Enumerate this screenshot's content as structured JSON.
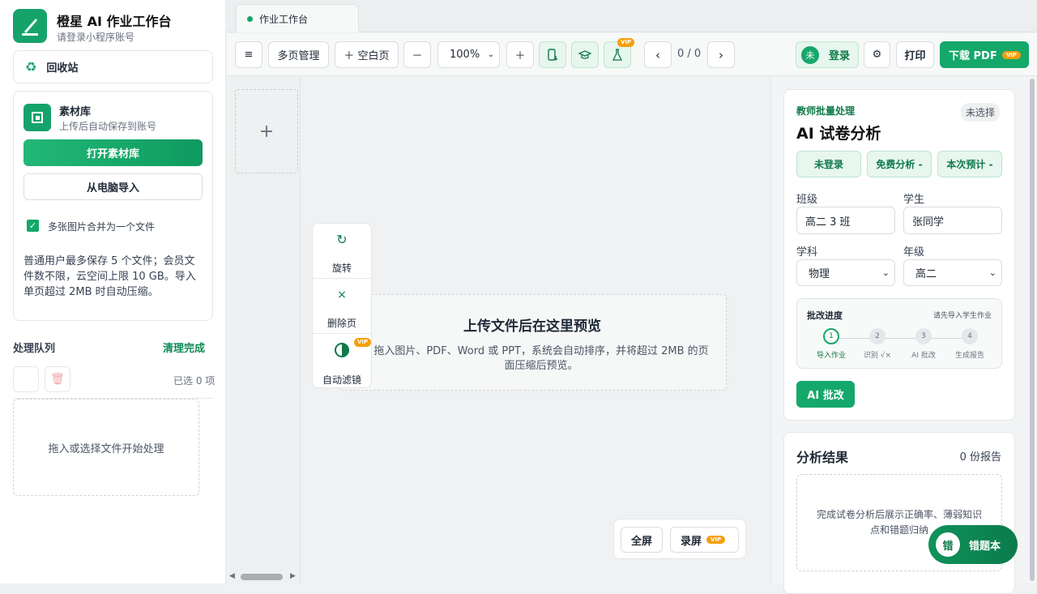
{
  "sidebar": {
    "app_title": "橙星 AI 作业工作台",
    "app_subtitle": "请登录小程序账号",
    "recycle": "回收站",
    "materials_title": "素材库",
    "materials_sub": "上传后自动保存到账号",
    "open_materials": "打开素材库",
    "import_pc": "从电脑导入",
    "merge_label": "多张图片合并为一个文件",
    "merge_checked": true,
    "note": "普通用户最多保存 5 个文件；会员文件数不限，云空间上限 10 GB。导入单页超过 2MB 时自动压缩。",
    "queue_title": "处理队列",
    "queue_clear": "清理完成",
    "queue_selected": "已选 0 项",
    "queue_empty": "拖入或选择文件开始处理"
  },
  "tab": {
    "label": "作业工作台"
  },
  "toolbar": {
    "menu_icon": "≡",
    "multi_page": "多页管理",
    "blank_page": "＋ 空白页",
    "zoom_out": "－",
    "zoom": "100%",
    "zoom_in": "＋",
    "vip": "VIP",
    "prev": "‹",
    "page_count": "0 / 0",
    "next": "›",
    "login_avatar": "未",
    "login": "登录",
    "settings": "⚙",
    "print": "打印",
    "download": "下载 PDF",
    "download_vip": "VIP"
  },
  "float_tools": {
    "rotate": "旋转",
    "delete": "删除页",
    "filter": "自动滤镜",
    "filter_vip": "VIP"
  },
  "preview": {
    "title": "上传文件后在这里预览",
    "desc": "拖入图片、PDF、Word 或 PPT，系统会自动排序，并将超过 2MB 的页面压缩后预览。"
  },
  "bottom": {
    "fullscreen": "全屏",
    "record": "录屏",
    "record_vip": "VIP"
  },
  "analysis": {
    "kicker": "教师批量处理",
    "status": "未选择",
    "title": "AI 试卷分析",
    "chip_login": "未登录",
    "chip_free": "免费分析 -",
    "chip_est": "本次预计 -",
    "class_label": "班级",
    "class_value": "高二 3 班",
    "student_label": "学生",
    "student_value": "张同学",
    "subject_label": "学科",
    "subject_value": "物理",
    "grade_label": "年级",
    "grade_value": "高二",
    "progress_title": "批改进度",
    "progress_hint": "请先导入学生作业",
    "steps": [
      {
        "n": "1",
        "label": "导入作业"
      },
      {
        "n": "2",
        "label": "识别 √×"
      },
      {
        "n": "3",
        "label": "AI 批改"
      },
      {
        "n": "4",
        "label": "生成报告"
      }
    ],
    "ai_button": "AI 批改"
  },
  "results": {
    "title": "分析结果",
    "count": "0 份报告",
    "empty": "完成试卷分析后展示正确率、薄弱知识点和错题归纳",
    "wrongbook_icon": "错",
    "wrongbook": "错题本"
  },
  "colors": {
    "accent": "#14a86a",
    "vip": "#f59e0b"
  }
}
